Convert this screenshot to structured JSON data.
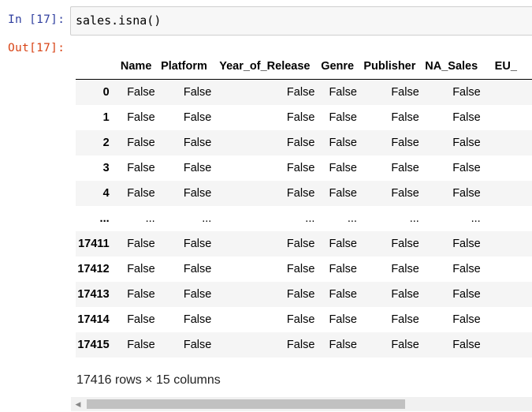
{
  "cell_in": {
    "prompt": "In [17]:",
    "code": "sales.isna()"
  },
  "cell_out": {
    "prompt": "Out[17]:"
  },
  "dataframe": {
    "columns": [
      "Name",
      "Platform",
      "Year_of_Release",
      "Genre",
      "Publisher",
      "NA_Sales",
      "EU_"
    ],
    "rows": [
      {
        "index": "0",
        "cells": [
          "False",
          "False",
          "False",
          "False",
          "False",
          "False",
          ""
        ]
      },
      {
        "index": "1",
        "cells": [
          "False",
          "False",
          "False",
          "False",
          "False",
          "False",
          ""
        ]
      },
      {
        "index": "2",
        "cells": [
          "False",
          "False",
          "False",
          "False",
          "False",
          "False",
          ""
        ]
      },
      {
        "index": "3",
        "cells": [
          "False",
          "False",
          "False",
          "False",
          "False",
          "False",
          ""
        ]
      },
      {
        "index": "4",
        "cells": [
          "False",
          "False",
          "False",
          "False",
          "False",
          "False",
          ""
        ]
      },
      {
        "index": "...",
        "cells": [
          "...",
          "...",
          "...",
          "...",
          "...",
          "...",
          ""
        ]
      },
      {
        "index": "17411",
        "cells": [
          "False",
          "False",
          "False",
          "False",
          "False",
          "False",
          ""
        ]
      },
      {
        "index": "17412",
        "cells": [
          "False",
          "False",
          "False",
          "False",
          "False",
          "False",
          ""
        ]
      },
      {
        "index": "17413",
        "cells": [
          "False",
          "False",
          "False",
          "False",
          "False",
          "False",
          ""
        ]
      },
      {
        "index": "17414",
        "cells": [
          "False",
          "False",
          "False",
          "False",
          "False",
          "False",
          ""
        ]
      },
      {
        "index": "17415",
        "cells": [
          "False",
          "False",
          "False",
          "False",
          "False",
          "False",
          ""
        ]
      }
    ],
    "summary": "17416 rows × 15 columns"
  }
}
